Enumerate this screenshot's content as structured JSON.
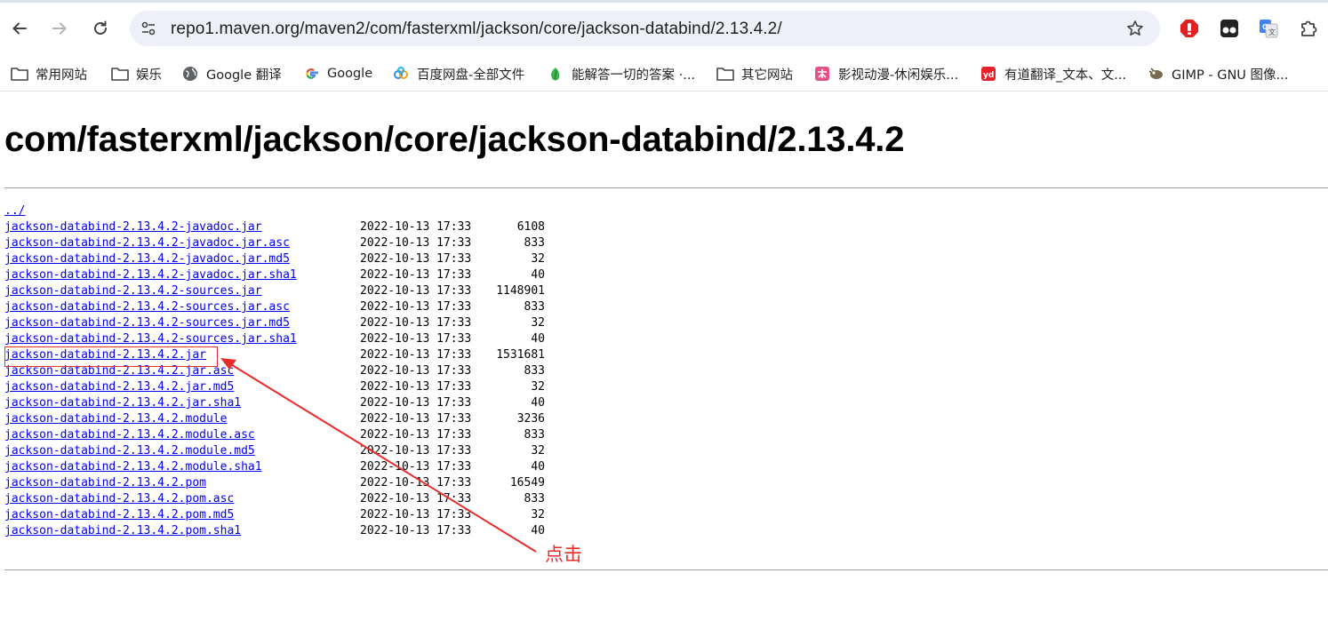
{
  "browser": {
    "url": "repo1.maven.org/maven2/com/fasterxml/jackson/core/jackson-databind/2.13.4.2/",
    "toolbar_icons": [
      "back-arrow-icon",
      "forward-arrow-icon",
      "reload-icon",
      "site-info-icon",
      "bookmark-star-icon",
      "adblock-extension-icon",
      "tampermonkey-extension-icon",
      "google-translate-extension-icon",
      "extensions-puzzle-icon"
    ],
    "bookmarks": [
      {
        "label": "常用网站",
        "icon": "folder-icon"
      },
      {
        "label": "娱乐",
        "icon": "folder-icon"
      },
      {
        "label": "Google 翻译",
        "icon": "globe-icon"
      },
      {
        "label": "Google",
        "icon": "google-icon"
      },
      {
        "label": "百度网盘-全部文件",
        "icon": "baidu-netdisk-icon"
      },
      {
        "label": "能解答一切的答案 ·...",
        "icon": "green-leaf-icon"
      },
      {
        "label": "其它网站",
        "icon": "folder-icon"
      },
      {
        "label": "影视动漫-休闲娱乐...",
        "icon": "pink-site-icon"
      },
      {
        "label": "有道翻译_文本、文...",
        "icon": "youdao-icon"
      },
      {
        "label": "GIMP - GNU 图像...",
        "icon": "gimp-icon"
      }
    ]
  },
  "page": {
    "title": "com/fasterxml/jackson/core/jackson-databind/2.13.4.2",
    "parent_link": "../",
    "files": [
      {
        "name": "jackson-databind-2.13.4.2-javadoc.jar",
        "date": "2022-10-13 17:33",
        "size": "6108"
      },
      {
        "name": "jackson-databind-2.13.4.2-javadoc.jar.asc",
        "date": "2022-10-13 17:33",
        "size": "833"
      },
      {
        "name": "jackson-databind-2.13.4.2-javadoc.jar.md5",
        "date": "2022-10-13 17:33",
        "size": "32"
      },
      {
        "name": "jackson-databind-2.13.4.2-javadoc.jar.sha1",
        "date": "2022-10-13 17:33",
        "size": "40"
      },
      {
        "name": "jackson-databind-2.13.4.2-sources.jar",
        "date": "2022-10-13 17:33",
        "size": "1148901"
      },
      {
        "name": "jackson-databind-2.13.4.2-sources.jar.asc",
        "date": "2022-10-13 17:33",
        "size": "833"
      },
      {
        "name": "jackson-databind-2.13.4.2-sources.jar.md5",
        "date": "2022-10-13 17:33",
        "size": "32"
      },
      {
        "name": "jackson-databind-2.13.4.2-sources.jar.sha1",
        "date": "2022-10-13 17:33",
        "size": "40"
      },
      {
        "name": "jackson-databind-2.13.4.2.jar",
        "date": "2022-10-13 17:33",
        "size": "1531681"
      },
      {
        "name": "jackson-databind-2.13.4.2.jar.asc",
        "date": "2022-10-13 17:33",
        "size": "833"
      },
      {
        "name": "jackson-databind-2.13.4.2.jar.md5",
        "date": "2022-10-13 17:33",
        "size": "32"
      },
      {
        "name": "jackson-databind-2.13.4.2.jar.sha1",
        "date": "2022-10-13 17:33",
        "size": "40"
      },
      {
        "name": "jackson-databind-2.13.4.2.module",
        "date": "2022-10-13 17:33",
        "size": "3236"
      },
      {
        "name": "jackson-databind-2.13.4.2.module.asc",
        "date": "2022-10-13 17:33",
        "size": "833"
      },
      {
        "name": "jackson-databind-2.13.4.2.module.md5",
        "date": "2022-10-13 17:33",
        "size": "32"
      },
      {
        "name": "jackson-databind-2.13.4.2.module.sha1",
        "date": "2022-10-13 17:33",
        "size": "40"
      },
      {
        "name": "jackson-databind-2.13.4.2.pom",
        "date": "2022-10-13 17:33",
        "size": "16549"
      },
      {
        "name": "jackson-databind-2.13.4.2.pom.asc",
        "date": "2022-10-13 17:33",
        "size": "833"
      },
      {
        "name": "jackson-databind-2.13.4.2.pom.md5",
        "date": "2022-10-13 17:33",
        "size": "32"
      },
      {
        "name": "jackson-databind-2.13.4.2.pom.sha1",
        "date": "2022-10-13 17:33",
        "size": "40"
      }
    ]
  },
  "annotation": {
    "text": "点击",
    "color": "#e82c2c"
  },
  "colors": {
    "link": "#0000ee",
    "omnibox_bg": "#edf0f7"
  }
}
